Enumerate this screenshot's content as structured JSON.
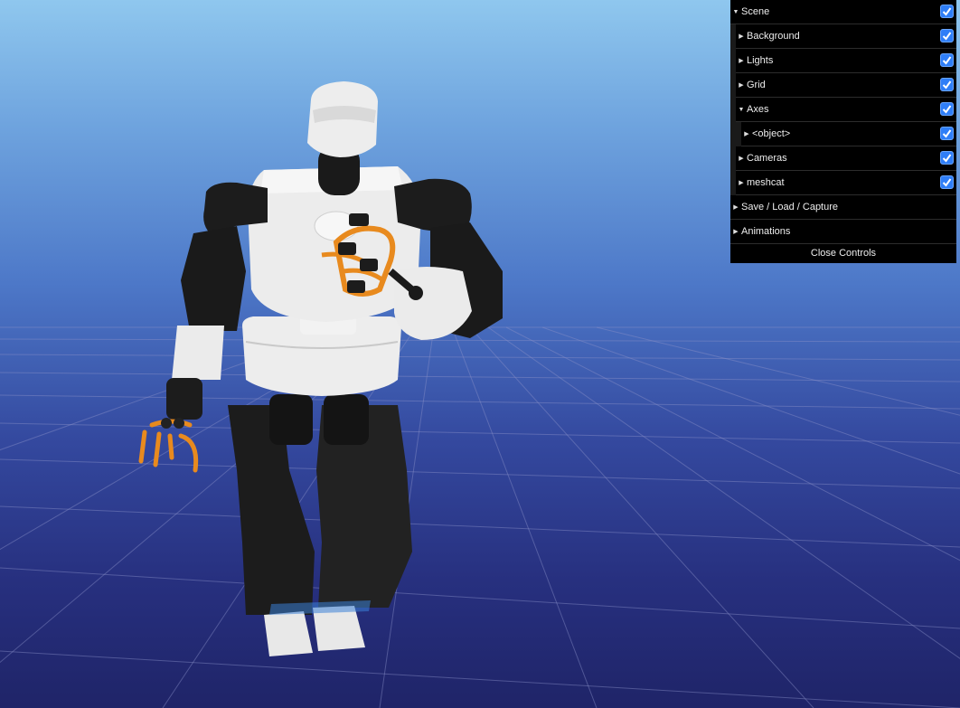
{
  "viewer": {
    "scene_description": "3D humanoid robot model on grid"
  },
  "controls": {
    "rows": [
      {
        "label": "Scene",
        "checked": true
      },
      {
        "label": "Background",
        "checked": true
      },
      {
        "label": "Lights",
        "checked": true
      },
      {
        "label": "Grid",
        "checked": true
      },
      {
        "label": "Axes",
        "checked": true
      },
      {
        "label": "<object>",
        "checked": true
      },
      {
        "label": "Cameras",
        "checked": true
      },
      {
        "label": "meshcat",
        "checked": true
      },
      {
        "label": "Save / Load / Capture"
      },
      {
        "label": "Animations"
      }
    ],
    "close_label": "Close Controls"
  },
  "icons": {
    "expand": "triangle-right-icon",
    "checkbox": "checkmark-icon"
  },
  "colors": {
    "panel_bg": "#000000",
    "checkbox_blue": "#2f7ef7",
    "sky_top": "#8fc7ee",
    "floor_bottom": "#1f2468",
    "robot_black": "#1c1c1c",
    "robot_white": "#ececec",
    "gripper_orange": "#e88a1e"
  }
}
